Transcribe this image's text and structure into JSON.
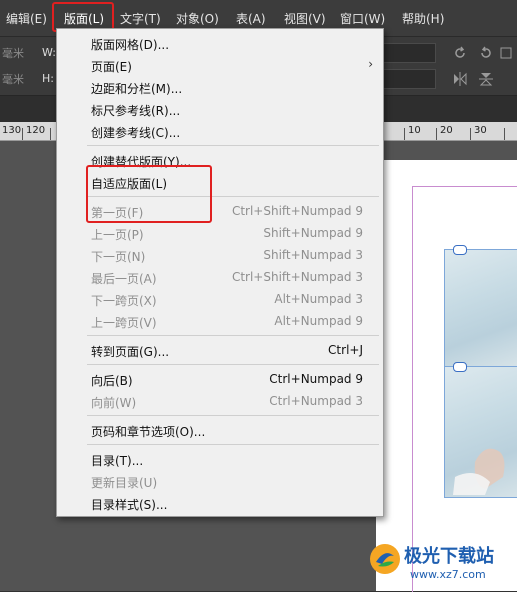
{
  "menubar": {
    "items": [
      {
        "label": "编辑(E)"
      },
      {
        "label": "版面(L)"
      },
      {
        "label": "文字(T)"
      },
      {
        "label": "对象(O)"
      },
      {
        "label": "表(A)"
      },
      {
        "label": "视图(V)"
      },
      {
        "label": "窗口(W)"
      },
      {
        "label": "帮助(H)"
      }
    ]
  },
  "control_bar": {
    "w_label": "W:",
    "h_label": "H:",
    "unit_top": "毫米",
    "unit_bottom": "毫米"
  },
  "ruler": {
    "left_labels": [
      "130",
      "120"
    ],
    "right_labels": [
      "10",
      "20",
      "30"
    ]
  },
  "layout_menu": {
    "items": [
      {
        "label": "版面网格(D)...",
        "shortcut": "",
        "enabled": true
      },
      {
        "label": "页面(E)",
        "shortcut": "",
        "enabled": true,
        "submenu": true
      },
      {
        "label": "边距和分栏(M)...",
        "shortcut": "",
        "enabled": true
      },
      {
        "label": "标尺参考线(R)...",
        "shortcut": "",
        "enabled": true
      },
      {
        "label": "创建参考线(C)...",
        "shortcut": "",
        "enabled": true
      },
      {
        "label": "创建替代版面(Y)...",
        "shortcut": "",
        "enabled": true
      },
      {
        "label": "自适应版面(L)",
        "shortcut": "",
        "enabled": true
      },
      {
        "label": "第一页(F)",
        "shortcut": "Ctrl+Shift+Numpad 9",
        "enabled": false
      },
      {
        "label": "上一页(P)",
        "shortcut": "Shift+Numpad 9",
        "enabled": false
      },
      {
        "label": "下一页(N)",
        "shortcut": "Shift+Numpad 3",
        "enabled": false
      },
      {
        "label": "最后一页(A)",
        "shortcut": "Ctrl+Shift+Numpad 3",
        "enabled": false
      },
      {
        "label": "下一跨页(X)",
        "shortcut": "Alt+Numpad 3",
        "enabled": false
      },
      {
        "label": "上一跨页(V)",
        "shortcut": "Alt+Numpad 9",
        "enabled": false
      },
      {
        "label": "转到页面(G)...",
        "shortcut": "Ctrl+J",
        "enabled": true
      },
      {
        "label": "向后(B)",
        "shortcut": "Ctrl+Numpad 9",
        "enabled": true
      },
      {
        "label": "向前(W)",
        "shortcut": "Ctrl+Numpad 3",
        "enabled": false
      },
      {
        "label": "页码和章节选项(O)...",
        "shortcut": "",
        "enabled": true
      },
      {
        "label": "目录(T)...",
        "shortcut": "",
        "enabled": true
      },
      {
        "label": "更新目录(U)",
        "shortcut": "",
        "enabled": false
      },
      {
        "label": "目录样式(S)...",
        "shortcut": "",
        "enabled": true
      }
    ]
  },
  "watermark": {
    "brand": "极光下载站",
    "url": "www.xz7.com"
  },
  "colors": {
    "highlight_box": "#e02020",
    "menu_bg": "#f0f0f0",
    "app_bg": "#323232",
    "disabled_text": "#8f8f8f"
  }
}
